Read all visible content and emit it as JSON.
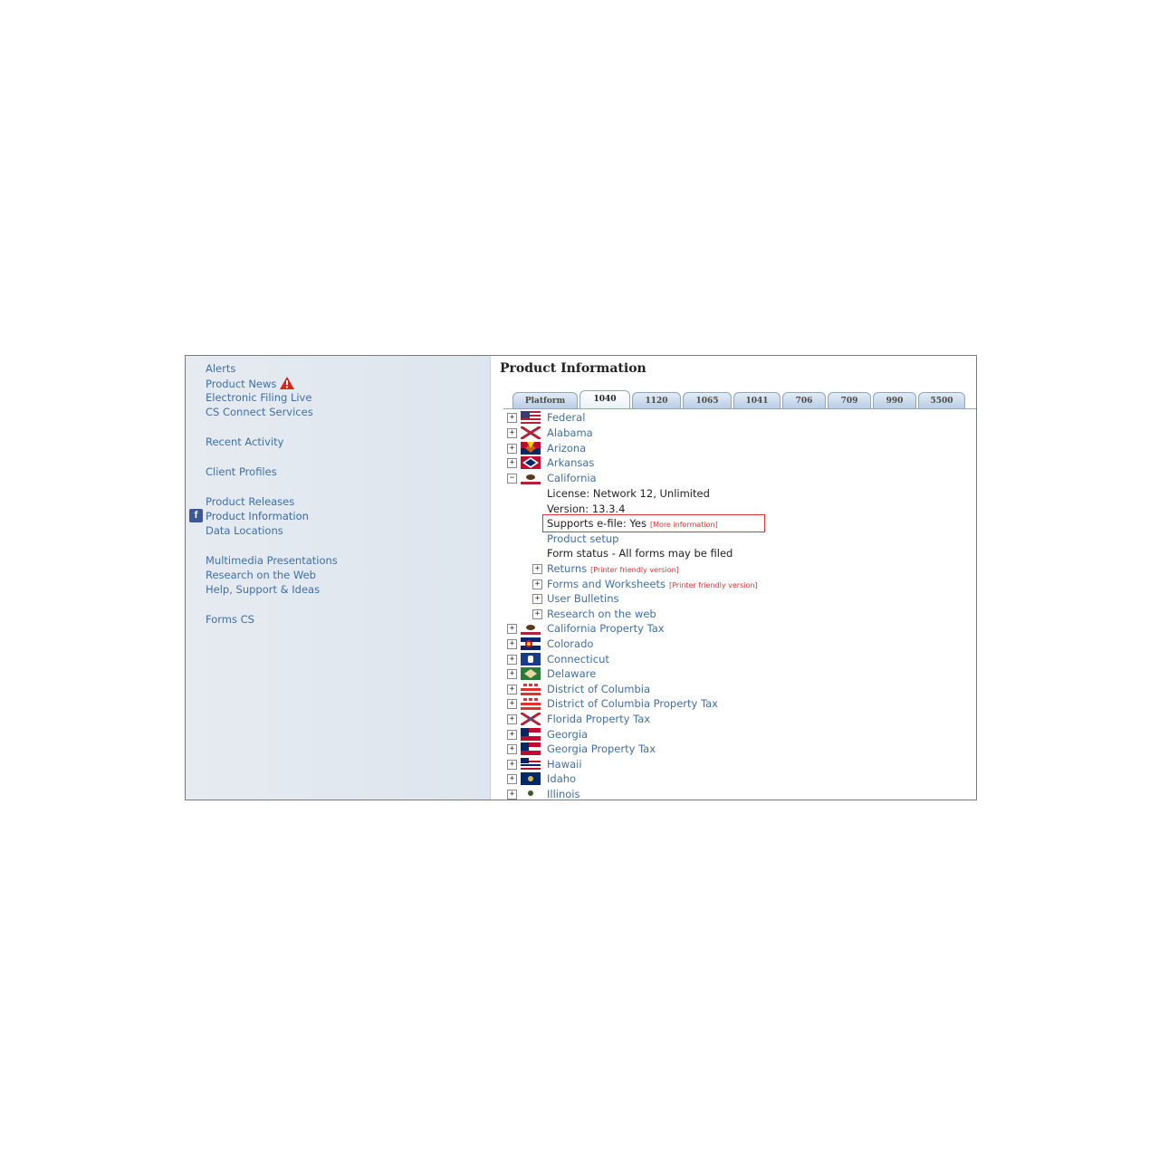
{
  "sidebar": {
    "alerts": "Alerts",
    "product_news": "Product News",
    "electronic_filing": "Electronic Filing Live",
    "cs_connect": "CS Connect Services",
    "recent_activity": "Recent Activity",
    "client_profiles": "Client Profiles",
    "product_releases": "Product Releases",
    "product_information": "Product Information",
    "data_locations": "Data Locations",
    "multimedia": "Multimedia Presentations",
    "research_web": "Research on the Web",
    "help": "Help, Support & Ideas",
    "forms_cs": "Forms CS"
  },
  "main": {
    "title": "Product Information",
    "tabs": [
      "Platform",
      "1040",
      "1120",
      "1065",
      "1041",
      "706",
      "709",
      "990",
      "5500"
    ],
    "active_tab": "1040",
    "states_before": [
      "Federal",
      "Alabama",
      "Arizona",
      "Arkansas"
    ],
    "expanded_state": "California",
    "details": {
      "license": "License: Network 12, Unlimited",
      "version": "Version: 13.3.4",
      "efile": "Supports e-file: Yes",
      "efile_more": "[More information]",
      "setup": "Product setup",
      "form_status": "Form status - All forms may be filed"
    },
    "subitems": {
      "returns": "Returns",
      "returns_print": "[Printer friendly version]",
      "forms": "Forms and Worksheets",
      "forms_print": "[Printer friendly version]",
      "bulletins": "User Bulletins",
      "research": "Research on the web"
    },
    "states_after": [
      "California Property Tax",
      "Colorado",
      "Connecticut",
      "Delaware",
      "District of Columbia",
      "District of Columbia Property Tax",
      "Florida Property Tax",
      "Georgia",
      "Georgia Property Tax",
      "Hawaii",
      "Idaho",
      "Illinois"
    ]
  },
  "colors": {
    "link": "#3f6fa6",
    "highlight": "#e23232",
    "sidebar_bg": "#e2e9f0"
  }
}
